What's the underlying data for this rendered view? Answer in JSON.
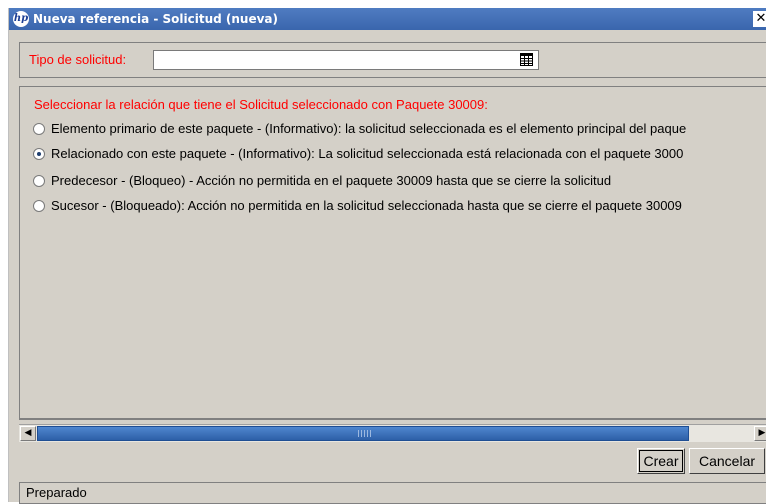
{
  "window": {
    "title": "Nueva referencia - Solicitud (nueva)",
    "close_glyph": "✕"
  },
  "form": {
    "request_type_label": "Tipo de solicitud:",
    "request_type_value": "",
    "request_type_icon": "calendar-grid-icon"
  },
  "relation": {
    "instruction": "Seleccionar la relación que tiene el Solicitud seleccionado con Paquete 30009:",
    "options": [
      {
        "label": "Elemento primario de este paquete - (Informativo): la solicitud seleccionada es el elemento principal del paque",
        "selected": false
      },
      {
        "label": "Relacionado con este paquete - (Informativo): La solicitud seleccionada está relacionada con el paquete 3000",
        "selected": true
      },
      {
        "label": "Predecesor - (Bloqueo) - Acción no permitida en el paquete 30009 hasta que se cierre la solicitud",
        "selected": false
      },
      {
        "label": "Sucesor - (Bloqueado): Acción no permitida en la solicitud seleccionada hasta que se cierre el paquete 30009",
        "selected": false
      }
    ]
  },
  "scrollbar": {
    "left_arrow": "◀",
    "right_arrow": "▶"
  },
  "buttons": {
    "create_label": "Crear",
    "cancel_label": "Cancelar"
  },
  "status": {
    "text": "Preparado"
  },
  "colors": {
    "titlebar": "#3a66ad",
    "required_label": "#ff0000",
    "scroll_thumb": "#2d5fa7"
  }
}
